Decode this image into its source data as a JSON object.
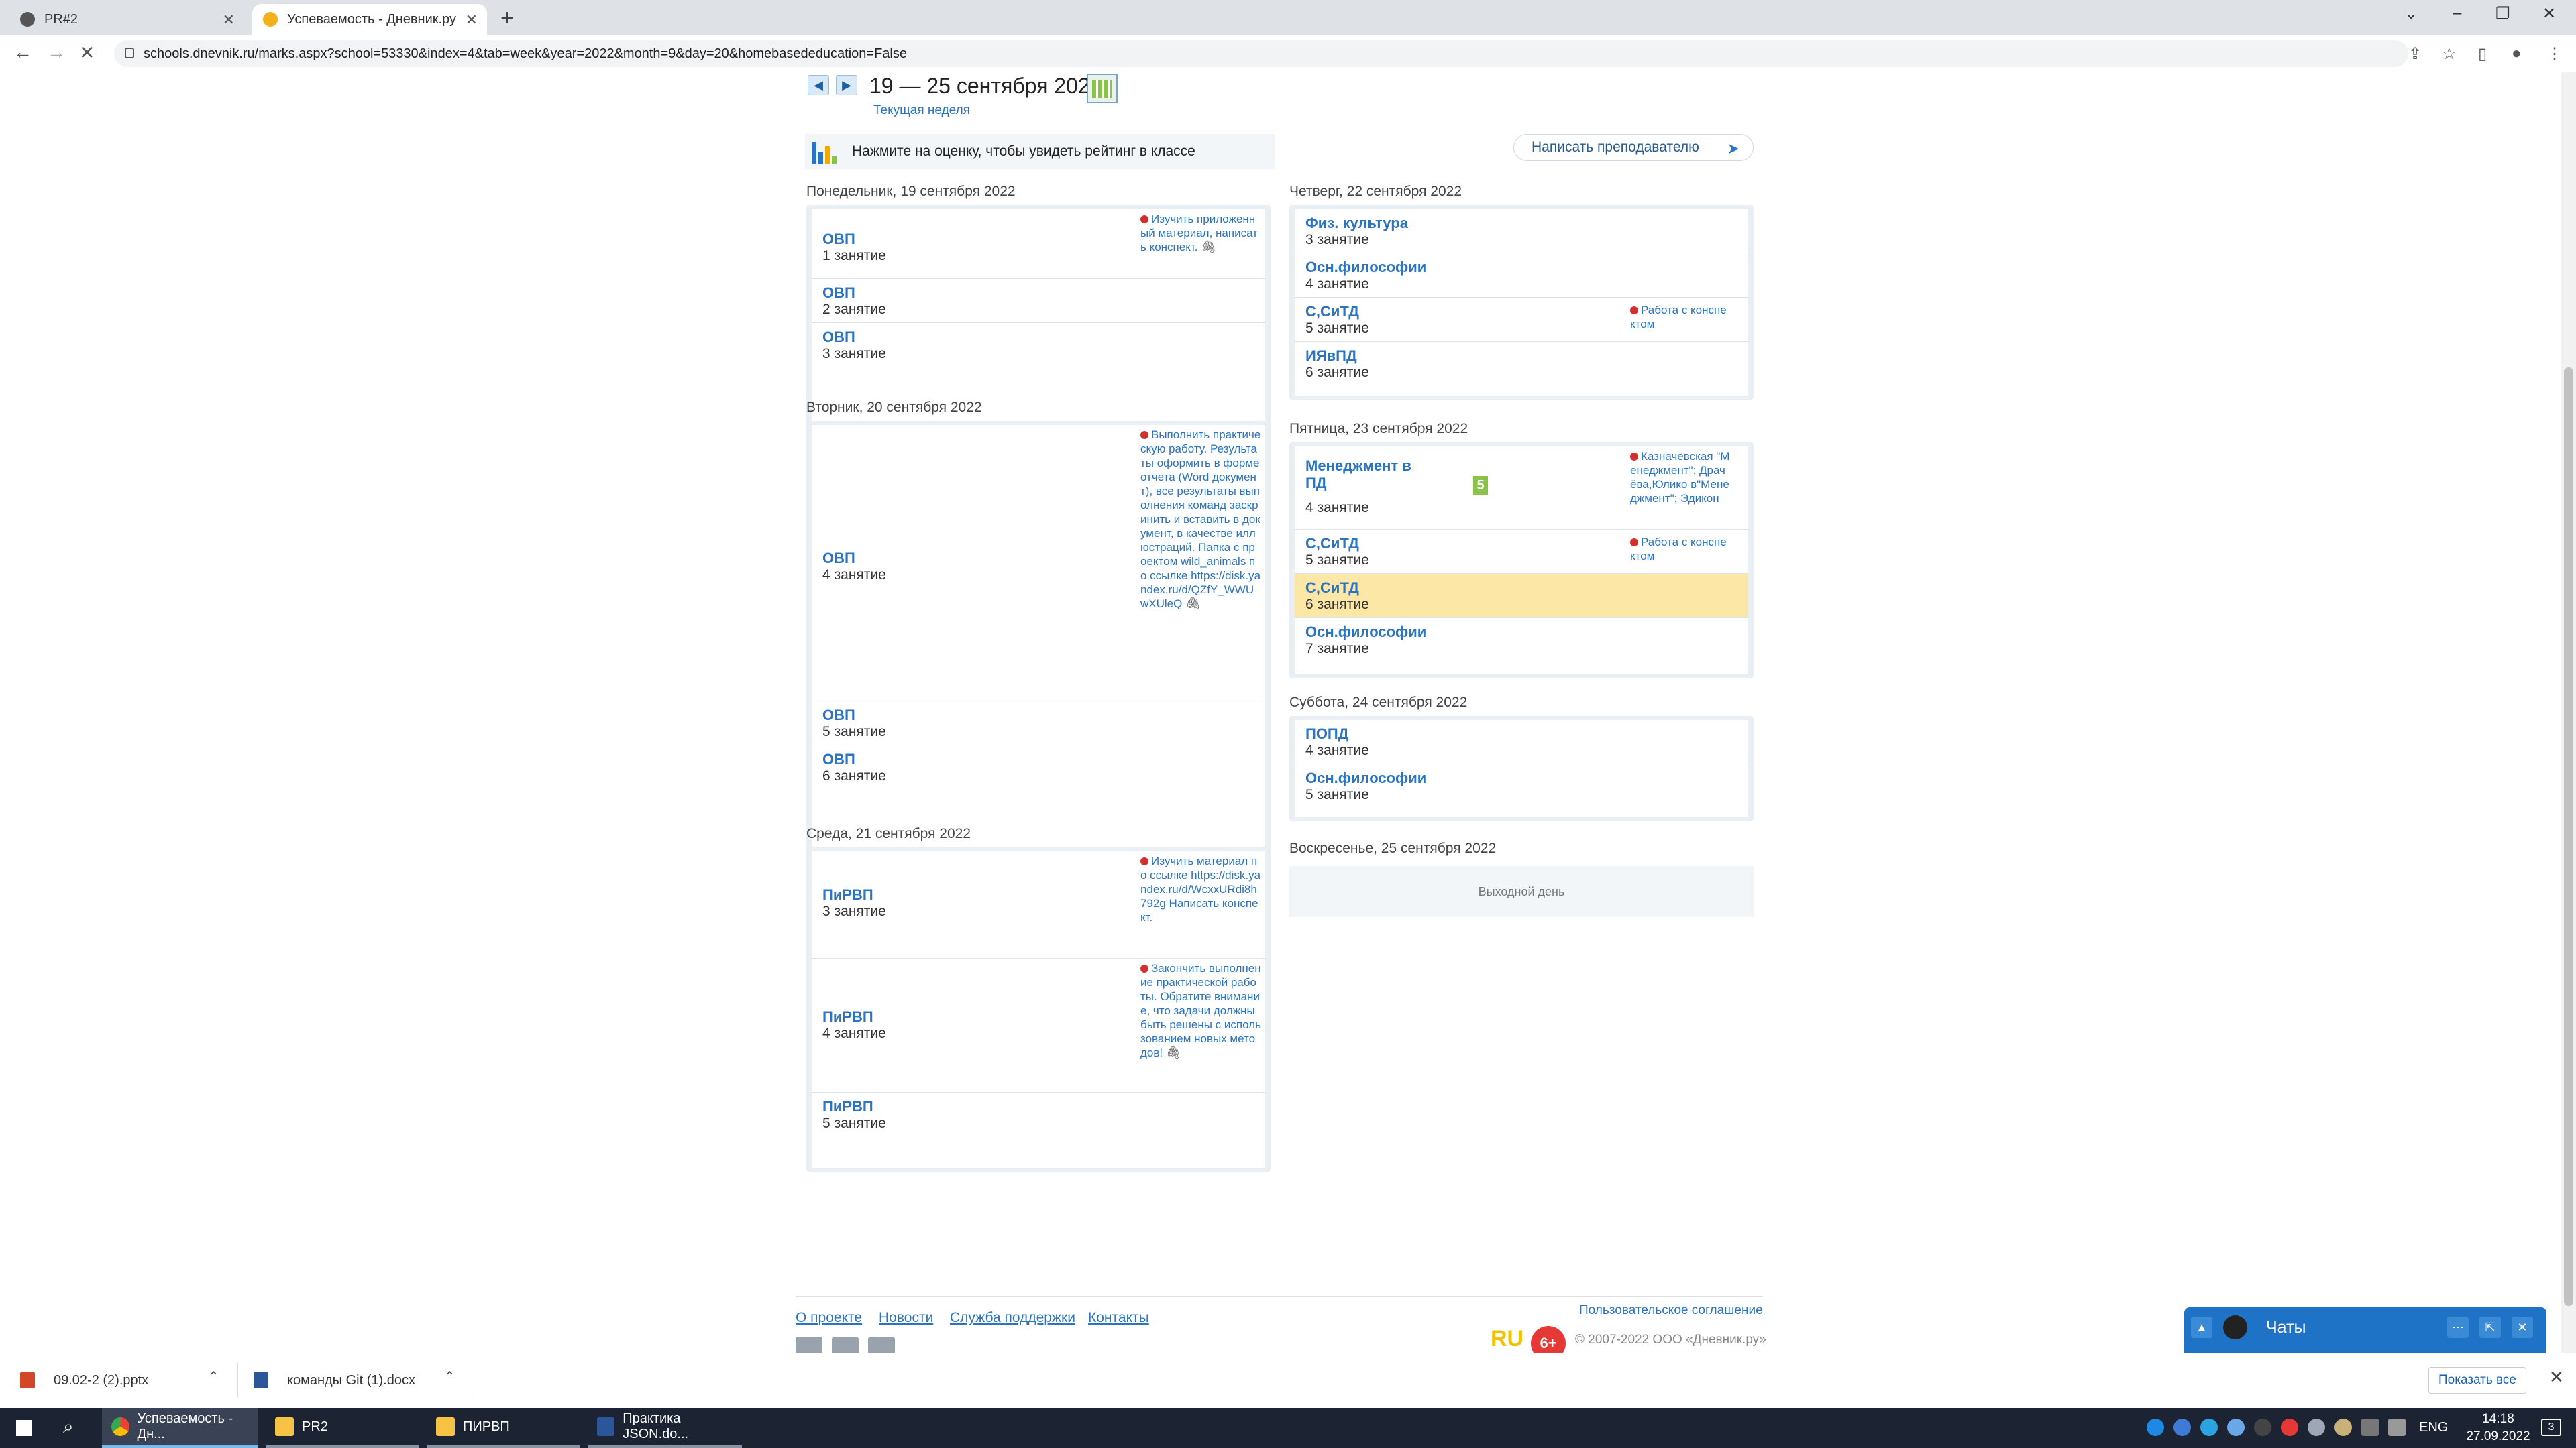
{
  "browser": {
    "tabs": [
      {
        "title": "PR#2"
      },
      {
        "title": "Успеваемость - Дневник.ру"
      }
    ],
    "url": "schools.dnevnik.ru/marks.aspx?school=53330&index=4&tab=week&year=2022&month=9&day=20&homebasededucation=False"
  },
  "week": {
    "title": "19 — 25 сентября 2022",
    "current_link": "Текущая неделя"
  },
  "rating_hint": "Нажмите на оценку, чтобы увидеть рейтинг в классе",
  "write_teacher": "Написать преподавателю",
  "days": {
    "mon": {
      "label": "Понедельник, 19 сентября 2022",
      "lessons": [
        {
          "subject": "ОВП",
          "number": "1 занятие",
          "hw": "Изучить приложенный материал, написать конспект."
        },
        {
          "subject": "ОВП",
          "number": "2 занятие"
        },
        {
          "subject": "ОВП",
          "number": "3 занятие"
        }
      ]
    },
    "tue": {
      "label": "Вторник, 20 сентября 2022",
      "lessons": [
        {
          "subject": "ОВП",
          "number": "4 занятие",
          "hw": "Выполнить практическую работу. Результаты оформить в форме отчета (Word документ), все результаты выполнения команд заскринить и вставить в документ, в качестве иллюстраций. Папка с проектом wild_animals по ссылке https://disk.yandex.ru/d/QZfY_WWUwXUleQ"
        },
        {
          "subject": "ОВП",
          "number": "5 занятие"
        },
        {
          "subject": "ОВП",
          "number": "6 занятие"
        }
      ]
    },
    "wed": {
      "label": "Среда, 21 сентября 2022",
      "lessons": [
        {
          "subject": "ПиРВП",
          "number": "3 занятие",
          "hw": "Изучить материал по ссылке https://disk.yandex.ru/d/WcxxURdi8h792g Написать конспект."
        },
        {
          "subject": "ПиРВП",
          "number": "4 занятие",
          "hw": "Закончить выполнение практической работы. Обратите внимание, что задачи должны быть решены с использованием новых методов!"
        },
        {
          "subject": "ПиРВП",
          "number": "5 занятие"
        }
      ]
    },
    "thu": {
      "label": "Четверг, 22 сентября 2022",
      "lessons": [
        {
          "subject": "Физ. культура",
          "number": "3 занятие"
        },
        {
          "subject": "Осн.философии",
          "number": "4 занятие"
        },
        {
          "subject": "С,СиТД",
          "number": "5 занятие",
          "hw": "Работа с конспектом"
        },
        {
          "subject": "ИЯвПД",
          "number": "6 занятие"
        }
      ]
    },
    "fri": {
      "label": "Пятница, 23 сентября 2022",
      "lessons": [
        {
          "subject": "Менеджмент в ПД",
          "number": "4 занятие",
          "grade": "5",
          "hw": "Казначевская \"Менеджмент\"; Драчёва,Юлико в\"Менеджмент\"; Эдикон"
        },
        {
          "subject": "С,СиТД",
          "number": "5 занятие",
          "hw": "Работа с конспектом"
        },
        {
          "subject": "С,СиТД",
          "number": "6 занятие"
        },
        {
          "subject": "Осн.философии",
          "number": "7 занятие"
        }
      ]
    },
    "sat": {
      "label": "Суббота, 24 сентября 2022",
      "lessons": [
        {
          "subject": "ПОПД",
          "number": "4 занятие"
        },
        {
          "subject": "Осн.философии",
          "number": "5 занятие"
        }
      ]
    },
    "sun": {
      "label": "Воскресенье, 25 сентября 2022",
      "day_off": "Выходной день"
    }
  },
  "footer": {
    "links": [
      "О проекте",
      "Новости",
      "Служба поддержки",
      "Контакты"
    ],
    "agreement": "Пользовательское соглашение",
    "copyright": "© 2007-2022 ООО «Дневник.ру»",
    "age": "6+",
    "ru_logo": "RU"
  },
  "chat": {
    "title": "Чаты"
  },
  "downloads": {
    "items": [
      "09.02-2 (2).pptx",
      "команды Git (1).docx"
    ],
    "show_all": "Показать все"
  },
  "taskbar": {
    "apps": [
      "Успеваемость - Дн...",
      "PR2",
      "ПИРВП",
      "Практика JSON.do..."
    ],
    "lang": "ENG",
    "time": "14:18",
    "date": "27.09.2022",
    "notifications": "3"
  },
  "colors": {
    "accent": "#2a74c2",
    "highlight": "#fde7a6",
    "grade": "#8bc34a",
    "chat": "#1f73c7"
  }
}
